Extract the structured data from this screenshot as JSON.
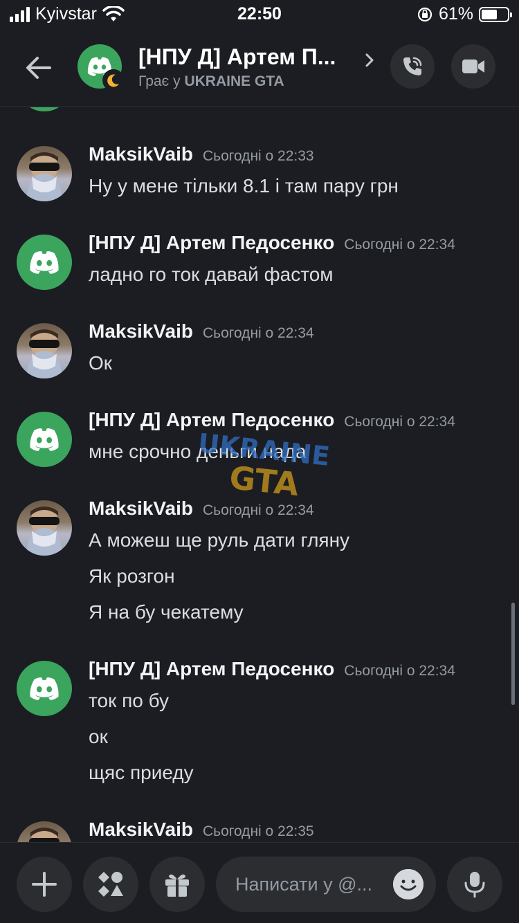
{
  "status_bar": {
    "carrier": "Kyivstar",
    "time": "22:50",
    "battery_percent": "61%",
    "battery_level": 0.61
  },
  "header": {
    "channel_name": "[НПУ Д] Артем П...",
    "activity_prefix": "Грає у",
    "activity_game": "UKRAINE GTA",
    "icons": [
      "back-arrow-icon",
      "discord-logo-icon",
      "moon-icon",
      "chevron-right-icon",
      "phone-call-icon",
      "video-camera-icon"
    ]
  },
  "messages": [
    {
      "author": "MaksikVaib",
      "time": "Сьогодні о 22:33",
      "lines": [
        "Ну у мене тільки 8.1 і там пару грн"
      ]
    },
    {
      "author": "[НПУ Д] Артем Педосенко",
      "time": "Сьогодні о 22:34",
      "lines": [
        "ладно го ток давай фастом"
      ]
    },
    {
      "author": "MaksikVaib",
      "time": "Сьогодні о 22:34",
      "lines": [
        "Ок"
      ]
    },
    {
      "author": "[НПУ Д] Артем Педосенко",
      "time": "Сьогодні о 22:34",
      "lines": [
        "мне срочно деньги нада"
      ]
    },
    {
      "author": "MaksikVaib",
      "time": "Сьогодні о 22:34",
      "lines": [
        "А можеш ще руль дати гляну",
        "Як розгон",
        "Я на бу чекатему"
      ]
    },
    {
      "author": "[НПУ Д] Артем Педосенко",
      "time": "Сьогодні о 22:34",
      "lines": [
        "ток по бу",
        "ок",
        "щяс приеду"
      ]
    },
    {
      "author": "MaksikVaib",
      "time": "Сьогодні о 22:35",
      "lines": []
    }
  ],
  "composer": {
    "placeholder": "Написати у @...",
    "icons": [
      "plus-icon",
      "apps-icon",
      "gift-icon",
      "emoji-icon",
      "microphone-icon"
    ]
  },
  "colors": {
    "background": "#1c1d22",
    "discord_green": "#3ba55d",
    "button_bg": "#2b2d31",
    "muted_text": "#949ba4"
  }
}
